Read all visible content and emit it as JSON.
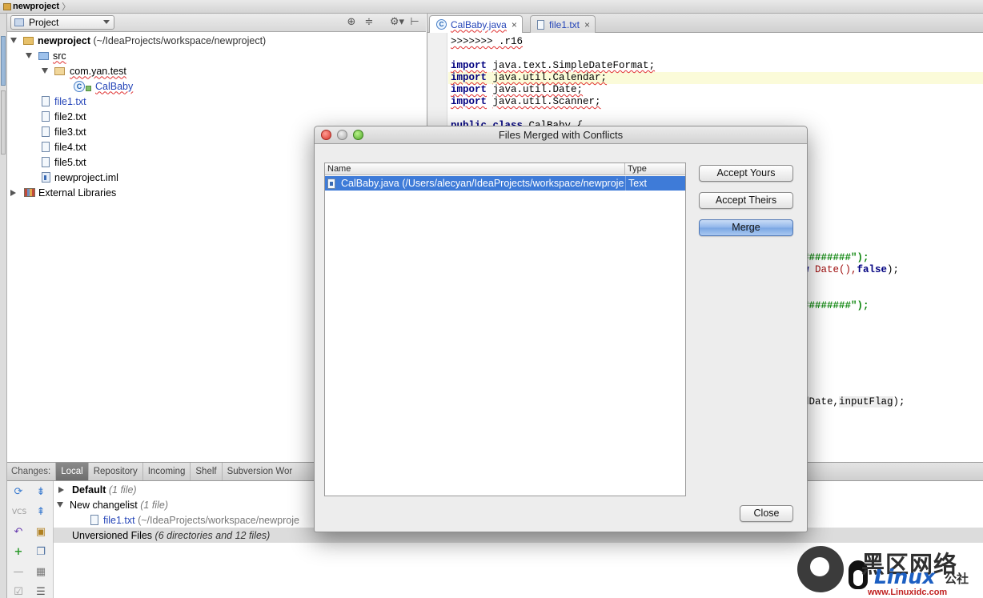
{
  "breadcrumb": {
    "project": "newproject",
    "chevron": "〉"
  },
  "project_panel": {
    "view_selector": "Project",
    "tools": {
      "locate": "⊕",
      "collapse": "≑",
      "settings": "⚙▾",
      "hide": "⊢"
    },
    "tree": {
      "root": {
        "name": "newproject",
        "path": "(~/IdeaProjects/workspace/newproject)"
      },
      "src": "src",
      "package": "com.yan.test",
      "class": "CalBaby",
      "files": [
        "file1.txt",
        "file2.txt",
        "file3.txt",
        "file4.txt",
        "file5.txt"
      ],
      "iml": "newproject.iml",
      "external": "External Libraries"
    }
  },
  "editor": {
    "tabs": [
      {
        "label": "CalBaby.java",
        "icon": "C",
        "close": "×"
      },
      {
        "label": "file1.txt",
        "close": "×"
      }
    ],
    "code": {
      "conflict_marker": ">>>>>>> .r16",
      "imports": [
        {
          "kw": "import",
          "pkg": "java.text.SimpleDateFormat;"
        },
        {
          "kw": "import",
          "pkg": "java.util.Calendar;"
        },
        {
          "kw": "import",
          "pkg": "java.util.Date;"
        },
        {
          "kw": "import",
          "pkg": "java.util.Scanner;"
        }
      ],
      "class_decl": {
        "kw": "public class",
        "name": "CalBaby {"
      },
      "frag1": "########\");",
      "frag2_pre": "w ",
      "frag2_date": "Date(),",
      "frag2_false": "false",
      "frag2_end": ");",
      "frag3": "########\");",
      "frag4_pre": "dDate,",
      "frag4_ident": "inputFlag",
      "frag4_end": ");"
    }
  },
  "changes": {
    "label": "Changes:",
    "tabs": [
      "Local",
      "Repository",
      "Incoming",
      "Shelf",
      "Subversion Wor"
    ],
    "groups": [
      {
        "name": "Default",
        "count": "(1 file)"
      },
      {
        "name": "New changelist",
        "count": "(1 file)"
      }
    ],
    "file": {
      "name": "file1.txt",
      "path": "(~/IdeaProjects/workspace/newproje"
    },
    "unversioned": {
      "name": "Unversioned Files",
      "count": "(6 directories and 12 files)"
    },
    "tool_icons": [
      "refresh-icon",
      "expand-icon",
      "vcs-icon",
      "collapse-icon",
      "rollback-icon",
      "group-icon",
      "add-icon",
      "copy-icon",
      "remove-icon",
      "shelve-icon",
      "check-icon",
      "list-icon"
    ]
  },
  "dialog": {
    "title": "Files Merged with Conflicts",
    "columns": {
      "name": "Name",
      "type": "Type"
    },
    "rows": [
      {
        "name": "CalBaby.java (/Users/alecyan/IdeaProjects/workspace/newproject/src/com/yan/test)",
        "type": "Text"
      }
    ],
    "buttons": {
      "accept_yours": "Accept Yours",
      "accept_theirs": "Accept Theirs",
      "merge": "Merge",
      "close": "Close"
    }
  },
  "watermark": {
    "cn": "黑区网络",
    "linux": "Linux",
    "gong": "公社",
    "url": "www.Linuxidc.com"
  }
}
